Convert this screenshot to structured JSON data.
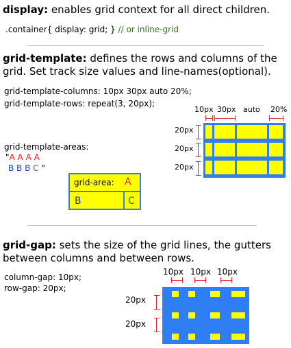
{
  "display": {
    "keyword": "display:",
    "desc": " enables grid context for all direct children.",
    "code": ".container{ display: grid; }",
    "comment": "// or inline-grid"
  },
  "template": {
    "keyword": "grid-template:",
    "desc1": " defines the rows and columns of the",
    "desc2": "grid. Set track size values and line-names(optional).",
    "code_columns": "grid-template-columns: 10px 30px auto 20%;",
    "code_rows": "grid-template-rows: repeat(3, 20px);",
    "col_labels": [
      "10px",
      "30px",
      "auto",
      "20%"
    ],
    "row_labels": [
      "20px",
      "20px",
      "20px"
    ],
    "areas_label": "grid-template-areas:",
    "areas_quote_open": "\"",
    "areas_row1": "A A A A",
    "areas_row2_b": "B B B",
    "areas_row2_c": "C",
    "areas_quote_close": "\"",
    "area_caption": "grid-area:",
    "area_a": "A",
    "area_b": "B",
    "area_c": "C"
  },
  "gap": {
    "keyword": "grid-gap:",
    "desc1": " sets the size of the grid lines, the gutters",
    "desc2": "between columns and between rows.",
    "code_col": "column-gap: 10px;",
    "code_row": "row-gap: 20px;",
    "col_labels": [
      "10px",
      "10px",
      "10px"
    ],
    "row_labels": [
      "20px",
      "20px"
    ]
  },
  "colors": {
    "grid": "#2f7ef3",
    "cell": "#ffff00",
    "mark": "#e8242b",
    "code_comment": "#2a7a10"
  }
}
